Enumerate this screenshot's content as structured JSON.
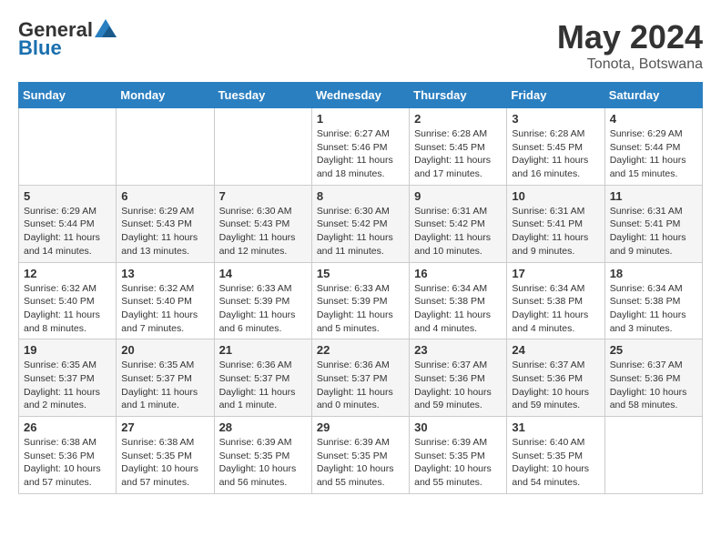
{
  "header": {
    "logo_general": "General",
    "logo_blue": "Blue",
    "month_year": "May 2024",
    "location": "Tonota, Botswana"
  },
  "weekdays": [
    "Sunday",
    "Monday",
    "Tuesday",
    "Wednesday",
    "Thursday",
    "Friday",
    "Saturday"
  ],
  "weeks": [
    [
      {
        "day": "",
        "info": ""
      },
      {
        "day": "",
        "info": ""
      },
      {
        "day": "",
        "info": ""
      },
      {
        "day": "1",
        "info": "Sunrise: 6:27 AM\nSunset: 5:46 PM\nDaylight: 11 hours and 18 minutes."
      },
      {
        "day": "2",
        "info": "Sunrise: 6:28 AM\nSunset: 5:45 PM\nDaylight: 11 hours and 17 minutes."
      },
      {
        "day": "3",
        "info": "Sunrise: 6:28 AM\nSunset: 5:45 PM\nDaylight: 11 hours and 16 minutes."
      },
      {
        "day": "4",
        "info": "Sunrise: 6:29 AM\nSunset: 5:44 PM\nDaylight: 11 hours and 15 minutes."
      }
    ],
    [
      {
        "day": "5",
        "info": "Sunrise: 6:29 AM\nSunset: 5:44 PM\nDaylight: 11 hours and 14 minutes."
      },
      {
        "day": "6",
        "info": "Sunrise: 6:29 AM\nSunset: 5:43 PM\nDaylight: 11 hours and 13 minutes."
      },
      {
        "day": "7",
        "info": "Sunrise: 6:30 AM\nSunset: 5:43 PM\nDaylight: 11 hours and 12 minutes."
      },
      {
        "day": "8",
        "info": "Sunrise: 6:30 AM\nSunset: 5:42 PM\nDaylight: 11 hours and 11 minutes."
      },
      {
        "day": "9",
        "info": "Sunrise: 6:31 AM\nSunset: 5:42 PM\nDaylight: 11 hours and 10 minutes."
      },
      {
        "day": "10",
        "info": "Sunrise: 6:31 AM\nSunset: 5:41 PM\nDaylight: 11 hours and 9 minutes."
      },
      {
        "day": "11",
        "info": "Sunrise: 6:31 AM\nSunset: 5:41 PM\nDaylight: 11 hours and 9 minutes."
      }
    ],
    [
      {
        "day": "12",
        "info": "Sunrise: 6:32 AM\nSunset: 5:40 PM\nDaylight: 11 hours and 8 minutes."
      },
      {
        "day": "13",
        "info": "Sunrise: 6:32 AM\nSunset: 5:40 PM\nDaylight: 11 hours and 7 minutes."
      },
      {
        "day": "14",
        "info": "Sunrise: 6:33 AM\nSunset: 5:39 PM\nDaylight: 11 hours and 6 minutes."
      },
      {
        "day": "15",
        "info": "Sunrise: 6:33 AM\nSunset: 5:39 PM\nDaylight: 11 hours and 5 minutes."
      },
      {
        "day": "16",
        "info": "Sunrise: 6:34 AM\nSunset: 5:38 PM\nDaylight: 11 hours and 4 minutes."
      },
      {
        "day": "17",
        "info": "Sunrise: 6:34 AM\nSunset: 5:38 PM\nDaylight: 11 hours and 4 minutes."
      },
      {
        "day": "18",
        "info": "Sunrise: 6:34 AM\nSunset: 5:38 PM\nDaylight: 11 hours and 3 minutes."
      }
    ],
    [
      {
        "day": "19",
        "info": "Sunrise: 6:35 AM\nSunset: 5:37 PM\nDaylight: 11 hours and 2 minutes."
      },
      {
        "day": "20",
        "info": "Sunrise: 6:35 AM\nSunset: 5:37 PM\nDaylight: 11 hours and 1 minute."
      },
      {
        "day": "21",
        "info": "Sunrise: 6:36 AM\nSunset: 5:37 PM\nDaylight: 11 hours and 1 minute."
      },
      {
        "day": "22",
        "info": "Sunrise: 6:36 AM\nSunset: 5:37 PM\nDaylight: 11 hours and 0 minutes."
      },
      {
        "day": "23",
        "info": "Sunrise: 6:37 AM\nSunset: 5:36 PM\nDaylight: 10 hours and 59 minutes."
      },
      {
        "day": "24",
        "info": "Sunrise: 6:37 AM\nSunset: 5:36 PM\nDaylight: 10 hours and 59 minutes."
      },
      {
        "day": "25",
        "info": "Sunrise: 6:37 AM\nSunset: 5:36 PM\nDaylight: 10 hours and 58 minutes."
      }
    ],
    [
      {
        "day": "26",
        "info": "Sunrise: 6:38 AM\nSunset: 5:36 PM\nDaylight: 10 hours and 57 minutes."
      },
      {
        "day": "27",
        "info": "Sunrise: 6:38 AM\nSunset: 5:35 PM\nDaylight: 10 hours and 57 minutes."
      },
      {
        "day": "28",
        "info": "Sunrise: 6:39 AM\nSunset: 5:35 PM\nDaylight: 10 hours and 56 minutes."
      },
      {
        "day": "29",
        "info": "Sunrise: 6:39 AM\nSunset: 5:35 PM\nDaylight: 10 hours and 55 minutes."
      },
      {
        "day": "30",
        "info": "Sunrise: 6:39 AM\nSunset: 5:35 PM\nDaylight: 10 hours and 55 minutes."
      },
      {
        "day": "31",
        "info": "Sunrise: 6:40 AM\nSunset: 5:35 PM\nDaylight: 10 hours and 54 minutes."
      },
      {
        "day": "",
        "info": ""
      }
    ]
  ]
}
